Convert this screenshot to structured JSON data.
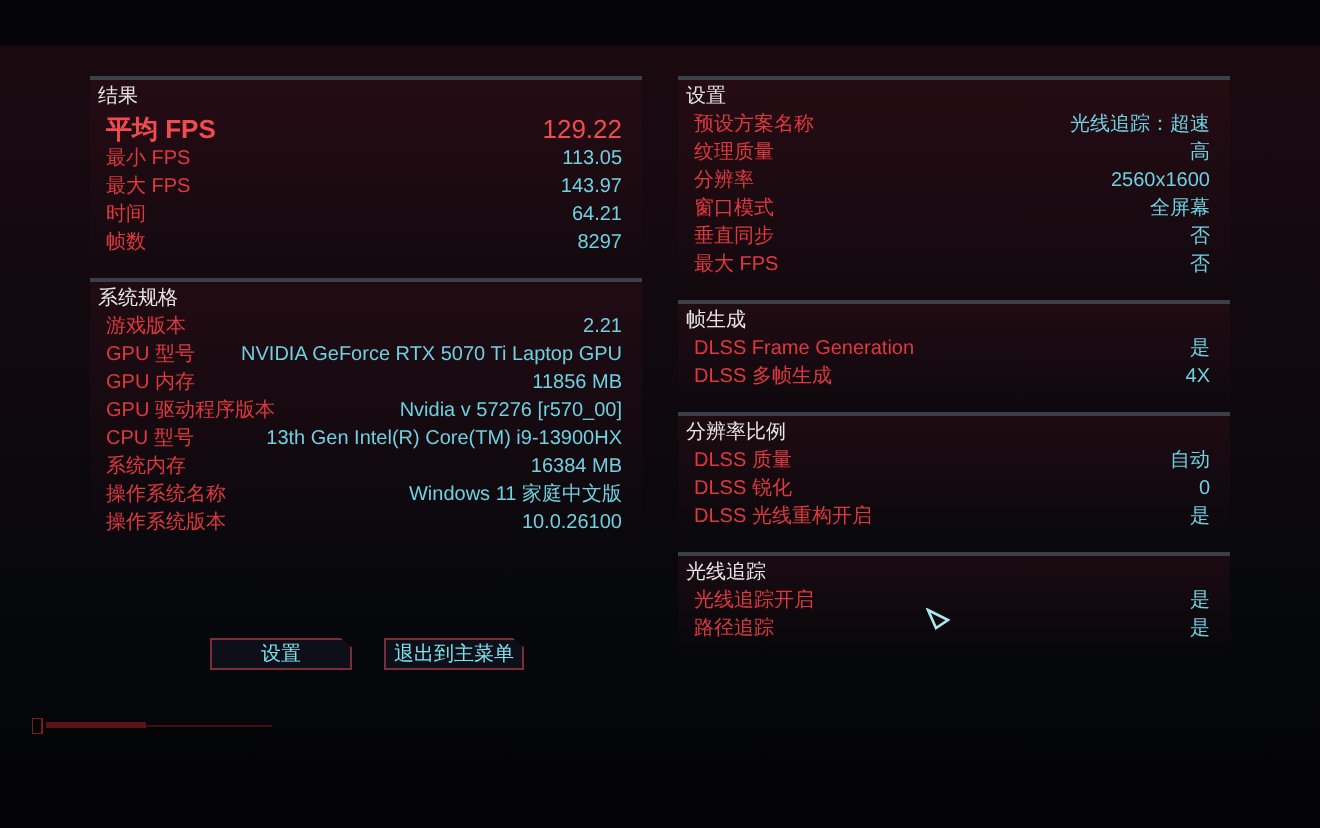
{
  "columns": [
    {
      "sections": [
        {
          "title": "结果",
          "rows": [
            {
              "kind": "primary",
              "label": "平均 FPS",
              "value": "129.22"
            },
            {
              "kind": "normal",
              "label": "最小 FPS",
              "value": "113.05"
            },
            {
              "kind": "normal",
              "label": "最大 FPS",
              "value": "143.97"
            },
            {
              "kind": "normal",
              "label": "时间",
              "value": "64.21"
            },
            {
              "kind": "normal",
              "label": "帧数",
              "value": "8297"
            }
          ]
        },
        {
          "title": "系统规格",
          "rows": [
            {
              "kind": "normal",
              "label": "游戏版本",
              "value": "2.21"
            },
            {
              "kind": "normal",
              "label": "GPU 型号",
              "value": "NVIDIA GeForce RTX 5070 Ti Laptop GPU"
            },
            {
              "kind": "normal",
              "label": "GPU 内存",
              "value": "11856 MB"
            },
            {
              "kind": "normal",
              "label": "GPU 驱动程序版本",
              "value": "Nvidia v 57276 [r570_00]"
            },
            {
              "kind": "normal",
              "label": "CPU 型号",
              "value": "13th Gen Intel(R) Core(TM) i9-13900HX"
            },
            {
              "kind": "normal",
              "label": "系统内存",
              "value": "16384 MB"
            },
            {
              "kind": "normal",
              "label": "操作系统名称",
              "value": "Windows 11 家庭中文版"
            },
            {
              "kind": "normal",
              "label": "操作系统版本",
              "value": "10.0.26100"
            }
          ]
        }
      ]
    },
    {
      "sections": [
        {
          "title": "设置",
          "rows": [
            {
              "kind": "normal",
              "label": "预设方案名称",
              "value": "光线追踪：超速"
            },
            {
              "kind": "normal",
              "label": "纹理质量",
              "value": "高"
            },
            {
              "kind": "normal",
              "label": "分辨率",
              "value": "2560x1600"
            },
            {
              "kind": "normal",
              "label": "窗口模式",
              "value": "全屏幕"
            },
            {
              "kind": "normal",
              "label": "垂直同步",
              "value": "否"
            },
            {
              "kind": "normal",
              "label": "最大 FPS",
              "value": "否"
            }
          ]
        },
        {
          "title": "帧生成",
          "rows": [
            {
              "kind": "normal",
              "label": "DLSS Frame Generation",
              "value": "是"
            },
            {
              "kind": "normal",
              "label": "DLSS 多帧生成",
              "value": "4X"
            }
          ]
        },
        {
          "title": "分辨率比例",
          "rows": [
            {
              "kind": "normal",
              "label": "DLSS 质量",
              "value": "自动"
            },
            {
              "kind": "normal",
              "label": "DLSS 锐化",
              "value": "0"
            },
            {
              "kind": "normal",
              "label": "DLSS 光线重构开启",
              "value": "是"
            }
          ]
        },
        {
          "title": "光线追踪",
          "rows": [
            {
              "kind": "normal",
              "label": "光线追踪开启",
              "value": "是"
            },
            {
              "kind": "normal",
              "label": "路径追踪",
              "value": "是"
            }
          ]
        }
      ]
    }
  ],
  "buttons": [
    "设置",
    "退出到主菜单"
  ]
}
